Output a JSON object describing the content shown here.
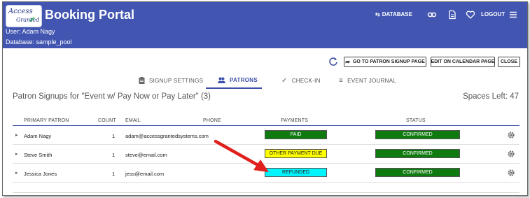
{
  "app": {
    "title": "Booking Portal",
    "logo_line1": "Access",
    "logo_line2": "Granted",
    "user_line": "User: Adam Nagy",
    "database_line": "Database: sample_pool",
    "nav_database": "DATABASE",
    "nav_logout": "LOGOUT"
  },
  "toolbar": {
    "go_to_signup": "GO TO PATRON SIGNUP PAGE",
    "edit_calendar": "EDIT ON CALENDAR PAGE",
    "close": "CLOSE"
  },
  "tabs": [
    {
      "label": "SIGNUP SETTINGS",
      "icon": "clipboard-icon"
    },
    {
      "label": "PATRONS",
      "icon": "people-icon"
    },
    {
      "label": "CHECK-IN",
      "icon": "check-icon"
    },
    {
      "label": "EVENT JOURNAL",
      "icon": "list-icon"
    }
  ],
  "section": {
    "title": "Patron Signups for \"Event w/ Pay Now or Pay Later\" (3)",
    "spaces_left": "Spaces Left: 47"
  },
  "table": {
    "headers": [
      "PRIMARY PATRON",
      "COUNT",
      "EMAIL",
      "PHONE",
      "PAYMENTS",
      "STATUS"
    ],
    "rows": [
      {
        "patron": "Adam Nagy",
        "count": "1",
        "email": "adam@accessgrantedsystems.com",
        "phone": "",
        "payment": "PAID",
        "status": "CONFIRMED"
      },
      {
        "patron": "Steve Smith",
        "count": "1",
        "email": "steve@email.com",
        "phone": "",
        "payment": "OTHER PAYMENT DUE",
        "status": "CONFIRMED"
      },
      {
        "patron": "Jessica Jones",
        "count": "1",
        "email": "jess@email.com",
        "phone": "",
        "payment": "REFUNDED",
        "status": "CONFIRMED"
      }
    ]
  },
  "colors": {
    "header": "#4256b1",
    "paid": "#0f7a0f",
    "payment_due": "#ffff00",
    "refunded": "#00f5ff",
    "confirmed": "#0f7a0f",
    "annotation_arrow": "#e0201c"
  }
}
